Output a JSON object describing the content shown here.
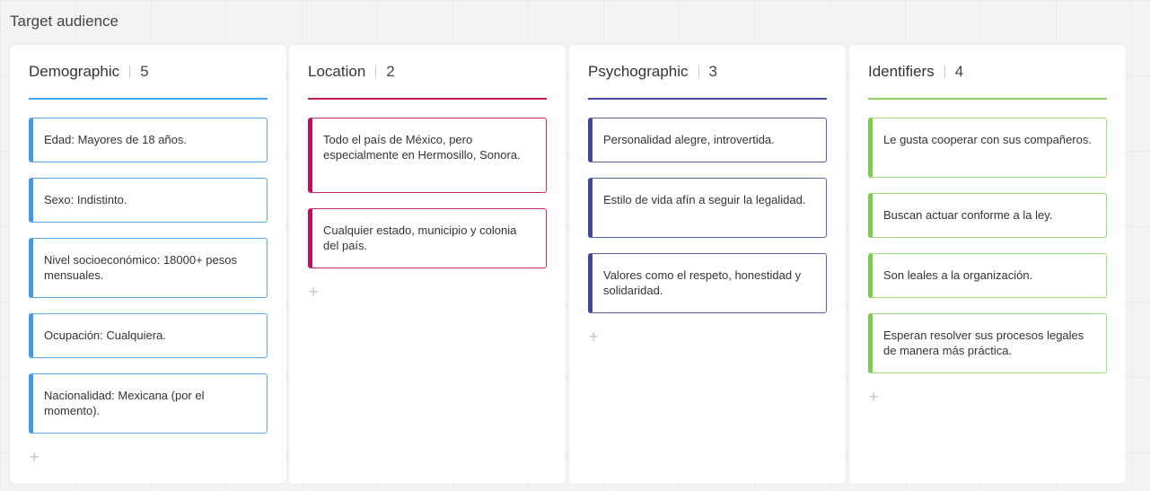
{
  "board": {
    "title": "Target audience"
  },
  "columns": [
    {
      "title": "Demographic",
      "count": "5",
      "accent": "#42a5f5",
      "cards": [
        "Edad: Mayores de 18 años.",
        "Sexo: Indistinto.",
        "Nivel socioeconómico: 18000+ pesos mensuales.",
        "Ocupación: Cualquiera.",
        "Nacionalidad: Mexicana (por el momento)."
      ],
      "add_label": "+"
    },
    {
      "title": "Location",
      "count": "2",
      "accent": "#c2185b",
      "cards": [
        "Todo el país de México, pero especialmente en Hermosillo, Sonora.",
        "Cualquier estado, municipio y colonia del país."
      ],
      "add_label": "+"
    },
    {
      "title": "Psychographic",
      "count": "3",
      "accent": "#3f4aa6",
      "cards": [
        "Personalidad alegre, introvertida.",
        "Estilo de vida afín a seguir la legalidad.",
        "Valores como el respeto, honestidad y solidaridad."
      ],
      "add_label": "+"
    },
    {
      "title": "Identifiers",
      "count": "4",
      "accent": "#8bd45c",
      "cards": [
        "Le gusta cooperar con sus compañeros.",
        "Buscan actuar conforme a la ley.",
        "Son leales a la organización.",
        "Esperan resolver sus procesos legales de manera más práctica."
      ],
      "add_label": "+"
    }
  ]
}
